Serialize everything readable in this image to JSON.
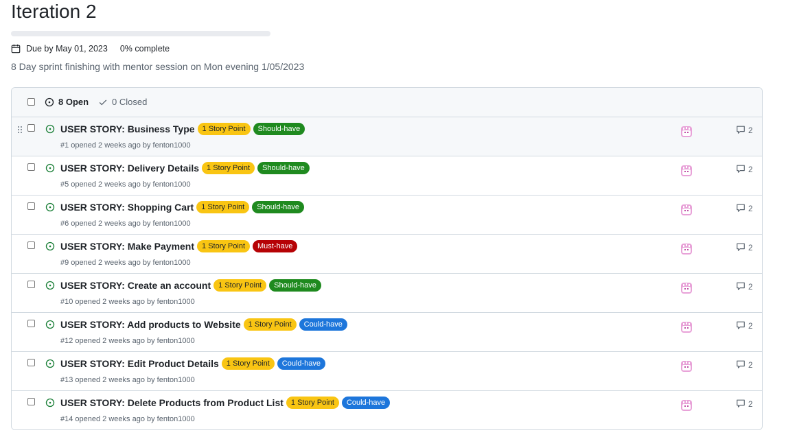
{
  "milestone": {
    "title": "Iteration 2",
    "progress_fraction": 0,
    "due_label": "Due by May 01, 2023",
    "percent_label": "0% complete",
    "description": "8 Day sprint finishing with mentor session on Mon evening 1/05/2023"
  },
  "header": {
    "open_label": "8 Open",
    "closed_label": "0 Closed"
  },
  "colors": {
    "open_green": "#1a7f37",
    "story_point_bg": "#f9c513",
    "should_have_bg": "#1f8a1f",
    "must_have_bg": "#b60205",
    "could_have_bg": "#1d76db",
    "avatar_pink": "#e07bc4"
  },
  "issues": [
    {
      "title": "USER STORY: Business Type",
      "labels": [
        {
          "text": "1 Story Point",
          "bg": "#f9c513",
          "fg": "#1f2328"
        },
        {
          "text": "Should-have",
          "bg": "#1f8a1f",
          "fg": "#ffffff"
        }
      ],
      "meta": "#1 opened 2 weeks ago by fenton1000",
      "comments": "2"
    },
    {
      "title": "USER STORY: Delivery Details",
      "labels": [
        {
          "text": "1 Story Point",
          "bg": "#f9c513",
          "fg": "#1f2328"
        },
        {
          "text": "Should-have",
          "bg": "#1f8a1f",
          "fg": "#ffffff"
        }
      ],
      "meta": "#5 opened 2 weeks ago by fenton1000",
      "comments": "2"
    },
    {
      "title": "USER STORY: Shopping Cart",
      "labels": [
        {
          "text": "1 Story Point",
          "bg": "#f9c513",
          "fg": "#1f2328"
        },
        {
          "text": "Should-have",
          "bg": "#1f8a1f",
          "fg": "#ffffff"
        }
      ],
      "meta": "#6 opened 2 weeks ago by fenton1000",
      "comments": "2"
    },
    {
      "title": "USER STORY: Make Payment",
      "labels": [
        {
          "text": "1 Story Point",
          "bg": "#f9c513",
          "fg": "#1f2328"
        },
        {
          "text": "Must-have",
          "bg": "#b60205",
          "fg": "#ffffff"
        }
      ],
      "meta": "#9 opened 2 weeks ago by fenton1000",
      "comments": "2"
    },
    {
      "title": "USER STORY: Create an account",
      "labels": [
        {
          "text": "1 Story Point",
          "bg": "#f9c513",
          "fg": "#1f2328"
        },
        {
          "text": "Should-have",
          "bg": "#1f8a1f",
          "fg": "#ffffff"
        }
      ],
      "meta": "#10 opened 2 weeks ago by fenton1000",
      "comments": "2"
    },
    {
      "title": "USER STORY: Add products to Website",
      "labels": [
        {
          "text": "1 Story Point",
          "bg": "#f9c513",
          "fg": "#1f2328"
        },
        {
          "text": "Could-have",
          "bg": "#1d76db",
          "fg": "#ffffff"
        }
      ],
      "meta": "#12 opened 2 weeks ago by fenton1000",
      "comments": "2"
    },
    {
      "title": "USER STORY: Edit Product Details",
      "labels": [
        {
          "text": "1 Story Point",
          "bg": "#f9c513",
          "fg": "#1f2328"
        },
        {
          "text": "Could-have",
          "bg": "#1d76db",
          "fg": "#ffffff"
        }
      ],
      "meta": "#13 opened 2 weeks ago by fenton1000",
      "comments": "2"
    },
    {
      "title": "USER STORY: Delete Products from Product List",
      "labels": [
        {
          "text": "1 Story Point",
          "bg": "#f9c513",
          "fg": "#1f2328"
        },
        {
          "text": "Could-have",
          "bg": "#1d76db",
          "fg": "#ffffff"
        }
      ],
      "meta": "#14 opened 2 weeks ago by fenton1000",
      "comments": "2"
    }
  ]
}
